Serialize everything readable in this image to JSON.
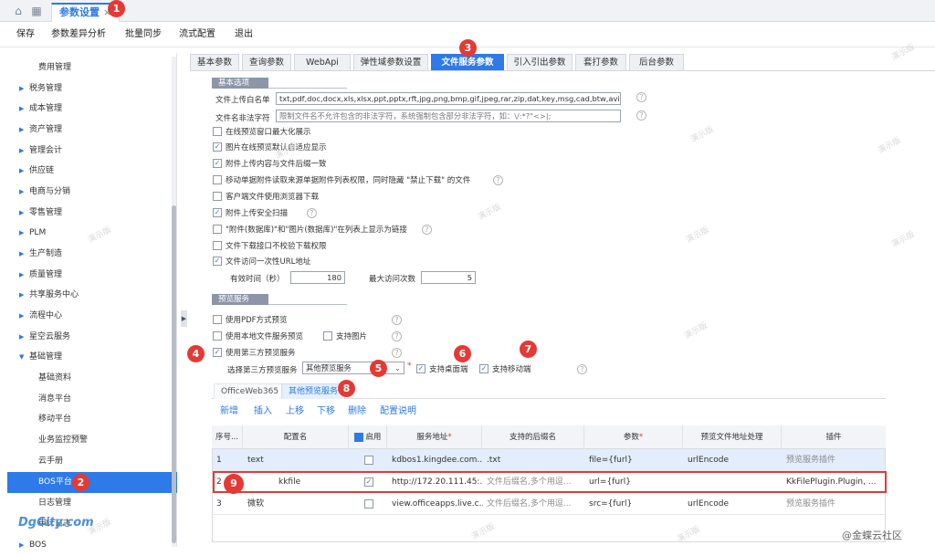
{
  "app": {
    "tab_title": "参数设置",
    "tab_close": "×",
    "home_icon": "home-icon",
    "apps_icon": "apps-grid-icon"
  },
  "toolbar": {
    "save": "保存",
    "diff": "参数差异分析",
    "batch_sync": "批量同步",
    "flow_config": "流式配置",
    "exit": "退出"
  },
  "sidebar": {
    "items": [
      {
        "label": "费用管理"
      },
      {
        "label": "税务管理"
      },
      {
        "label": "成本管理"
      },
      {
        "label": "资产管理"
      },
      {
        "label": "管理会计"
      },
      {
        "label": "供应链"
      },
      {
        "label": "电商与分销"
      },
      {
        "label": "零售管理"
      },
      {
        "label": "PLM"
      },
      {
        "label": "生产制造"
      },
      {
        "label": "质量管理"
      },
      {
        "label": "共享服务中心"
      },
      {
        "label": "流程中心"
      },
      {
        "label": "星空云服务"
      },
      {
        "label": "基础管理"
      },
      {
        "label": "基础资料"
      },
      {
        "label": "消息平台"
      },
      {
        "label": "移动平台"
      },
      {
        "label": "业务监控预警"
      },
      {
        "label": "云手册"
      },
      {
        "label": "BOS平台"
      },
      {
        "label": "日志管理"
      },
      {
        "label": "审计日志"
      },
      {
        "label": "BOS"
      }
    ]
  },
  "param_tabs": [
    {
      "label": "基本参数"
    },
    {
      "label": "查询参数"
    },
    {
      "label": "WebApi"
    },
    {
      "label": "弹性域参数设置"
    },
    {
      "label": "文件服务参数"
    },
    {
      "label": "引入引出参数"
    },
    {
      "label": "套打参数"
    },
    {
      "label": "后台参数"
    }
  ],
  "basic": {
    "section_title": "基本选项",
    "whitelist_label": "文件上传白名单",
    "whitelist_value": "txt,pdf,doc,docx,xls,xlsx,ppt,pptx,rft,jpg,png,bmp,gif,jpeg,rar,zip,dat,key,msg,cad,btw,avi,rmvb",
    "illegal_label": "文件名非法字符",
    "illegal_placeholder": "限制文件名不允许包含的非法字符，系统强制包含部分非法字符，如：\\/:*?\"<>|;",
    "options": [
      {
        "label": "在线预览窗口最大化展示",
        "checked": false
      },
      {
        "label": "图片在线预览默认自适应显示",
        "checked": true
      },
      {
        "label": "附件上传内容与文件后缀一致",
        "checked": true
      },
      {
        "label": "移动单据附件读取来源单据附件列表权限，同时隐藏 \"禁止下载\" 的文件",
        "checked": false
      },
      {
        "label": "客户端文件使用浏览器下载",
        "checked": false
      },
      {
        "label": "附件上传安全扫描",
        "checked": true
      },
      {
        "label": "\"附件(数据库)\"和\"图片(数据库)\"在列表上显示为链接",
        "checked": false
      },
      {
        "label": "文件下载接口不校验下载权限",
        "checked": false
      },
      {
        "label": "文件访问一次性URL地址",
        "checked": true
      }
    ],
    "valid_time_label": "有效时间（秒）",
    "valid_time_value": "180",
    "max_visits_label": "最大访问次数",
    "max_visits_value": "5"
  },
  "preview": {
    "section_title": "预览服务",
    "use_pdf": "使用PDF方式预览",
    "use_local": "使用本地文件服务预览",
    "support_image": "支持图片",
    "use_third": "使用第三方预览服务",
    "select_label": "选择第三方预览服务",
    "select_value": "其他预览服务",
    "required_mark": "*",
    "support_desktop": "支持桌面端",
    "support_mobile": "支持移动端",
    "subtabs": [
      {
        "label": "OfficeWeb365"
      },
      {
        "label": "其他预览服务"
      }
    ]
  },
  "grid_toolbar": {
    "add": "新增",
    "insert": "插入",
    "up": "上移",
    "down": "下移",
    "delete": "删除",
    "config_help": "配置说明"
  },
  "grid": {
    "headers": [
      "序号...",
      "配置名",
      "启用",
      "服务地址",
      "支持的后缀名",
      "参数",
      "预览文件地址处理",
      "插件"
    ],
    "required_mark": "*",
    "rows": [
      {
        "seq": "1",
        "name": "text",
        "enabled": false,
        "url": "kdbos1.kingdee.com...",
        "suffix": ".txt",
        "suffix_hint": false,
        "param": "file={furl}",
        "handle": "urlEncode",
        "plugin": "预览服务插件",
        "plugin_hint": true
      },
      {
        "seq": "2",
        "name": "kkfile",
        "enabled": true,
        "url": "http://172.20.111.45:...",
        "suffix": "文件后缀名,多个用逗...",
        "suffix_hint": true,
        "param": "url={furl}",
        "handle": "",
        "plugin": "KkFilePlugin.Plugin, ...",
        "plugin_hint": false
      },
      {
        "seq": "3",
        "name": "微软",
        "enabled": false,
        "url": "view.officeapps.live.c...",
        "suffix": "文件后缀名,多个用逗...",
        "suffix_hint": true,
        "param": "src={furl}",
        "handle": "urlEncode",
        "plugin": "预览服务插件",
        "plugin_hint": true
      }
    ]
  },
  "badges": [
    "1",
    "2",
    "3",
    "4",
    "5",
    "6",
    "7",
    "8",
    "9"
  ],
  "watermark": "演示版",
  "footer": {
    "logo": "DgCity.com",
    "brand": "@金蝶云社区"
  },
  "colors": {
    "accent": "#2d7ae8",
    "badge_red": "#e53935"
  }
}
